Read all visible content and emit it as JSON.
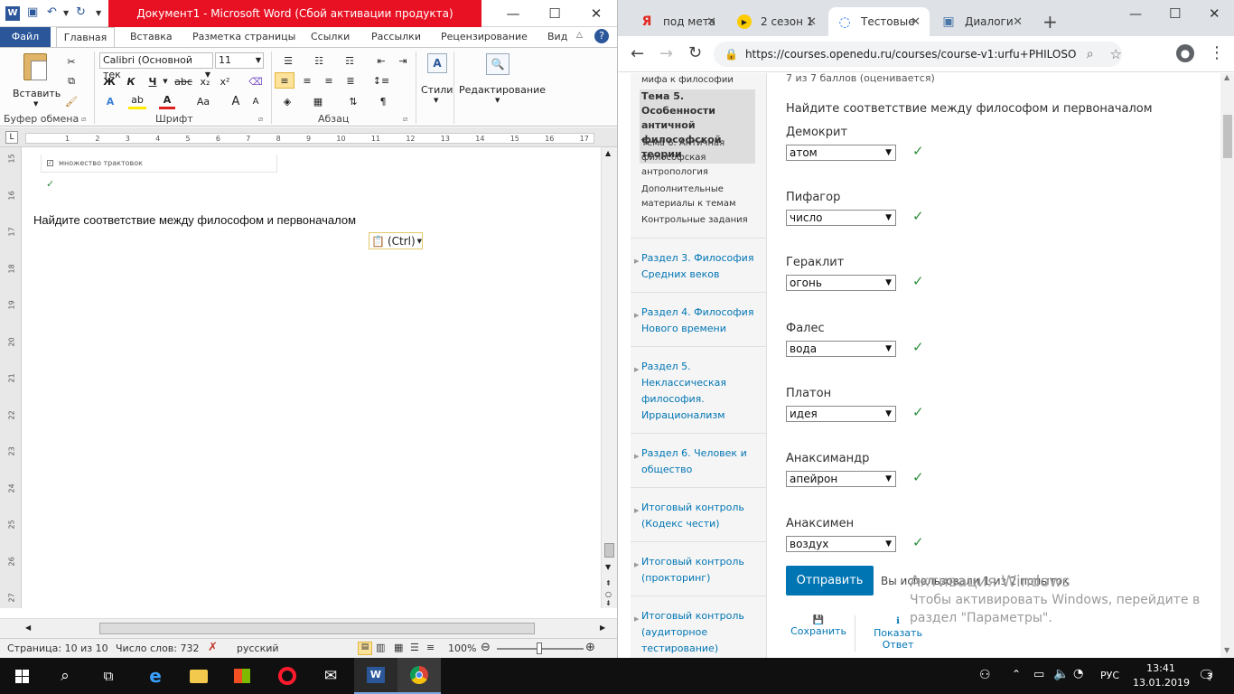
{
  "word": {
    "title": "Документ1  -  Microsoft Word (Сбой активации продукта)",
    "tabs": [
      "Файл",
      "Главная",
      "Вставка",
      "Разметка страницы",
      "Ссылки",
      "Рассылки",
      "Рецензирование",
      "Вид"
    ],
    "ribbon": {
      "paste_label": "Вставить",
      "clipboard_label": "Буфер обмена",
      "font_name": "Calibri (Основной тек",
      "font_size": "11",
      "font_label": "Шрифт",
      "paragraph_label": "Абзац",
      "styles_label": "Стили",
      "editing_label": "Редактирование",
      "bold": "Ж",
      "italic": "К",
      "underline": "Ч",
      "strike": "abc",
      "grow": "A",
      "change_case": "Aa",
      "pilcrow": "¶"
    },
    "doc": {
      "prev_item": "множество трактовок",
      "heading": "Найдите соответствие между философом и первоначалом",
      "paste_options": "(Ctrl)"
    },
    "status": {
      "page": "Страница: 10 из 10",
      "words": "Число слов: 732",
      "lang": "русский",
      "zoom": "100%"
    },
    "ruler_numbers": [
      "1",
      "2",
      "3",
      "4",
      "5",
      "6",
      "7",
      "8",
      "9",
      "10",
      "11",
      "12",
      "13",
      "14",
      "15",
      "16",
      "17"
    ],
    "vruler_numbers": [
      "15",
      "16",
      "17",
      "18",
      "19",
      "20",
      "21",
      "22",
      "23",
      "24",
      "25",
      "26",
      "27"
    ]
  },
  "chrome": {
    "tabs": [
      {
        "title": "под мета",
        "icon": "Я"
      },
      {
        "title": "2 сезон 1",
        "icon": "▶"
      },
      {
        "title": "Тестовые",
        "icon": "◌"
      },
      {
        "title": "Диалоги",
        "icon": "▣"
      }
    ],
    "url": "https://courses.openedu.ru/courses/course-v1:urfu+PHILOSO...",
    "sidebar": {
      "sub_items": [
        "мифа к философии",
        "Тема 5. Особенности античной философской теории",
        "Тема 6. Античная философская антропология",
        "Дополнительные материалы к темам",
        "Контрольные задания"
      ],
      "sections": [
        "Раздел 3. Философия Средних веков",
        "Раздел 4. Философия Нового времени",
        "Раздел 5. Неклассическая философия. Иррационализм",
        "Раздел 6. Человек и общество",
        "Итоговый контроль (Кодекс чести)",
        "Итоговый контроль (прокторинг)",
        "Итоговый контроль (аудиторное тестирование)"
      ]
    },
    "main": {
      "score": "7 из 7 баллов (оценивается)",
      "question": "Найдите соответствие между философом и первоначалом",
      "pairs": [
        {
          "philosopher": "Демокрит",
          "answer": "атом"
        },
        {
          "philosopher": "Пифагор",
          "answer": "число"
        },
        {
          "philosopher": "Гераклит",
          "answer": "огонь"
        },
        {
          "philosopher": "Фалес",
          "answer": "вода"
        },
        {
          "philosopher": "Платон",
          "answer": "идея"
        },
        {
          "philosopher": "Анаксимандр",
          "answer": "апейрон"
        },
        {
          "philosopher": "Анаксимен",
          "answer": "воздух"
        }
      ],
      "submit": "Отправить",
      "attempts": "Вы использовали 1 из 2 попыток",
      "save": "Сохранить",
      "show_answer": "Показать Ответ"
    }
  },
  "watermark": {
    "line1": "Активация Windows",
    "line2": "Чтобы активировать Windows, перейдите в раздел \"Параметры\"."
  },
  "taskbar": {
    "lang": "РУС",
    "time": "13:41",
    "date": "13.01.2019",
    "notifications": "3"
  },
  "colors": {
    "word_blue": "#2b579a",
    "word_red": "#e81123",
    "link_blue": "#0075b4",
    "submit_blue": "#0075b4",
    "check_green": "#2b8e3a"
  }
}
